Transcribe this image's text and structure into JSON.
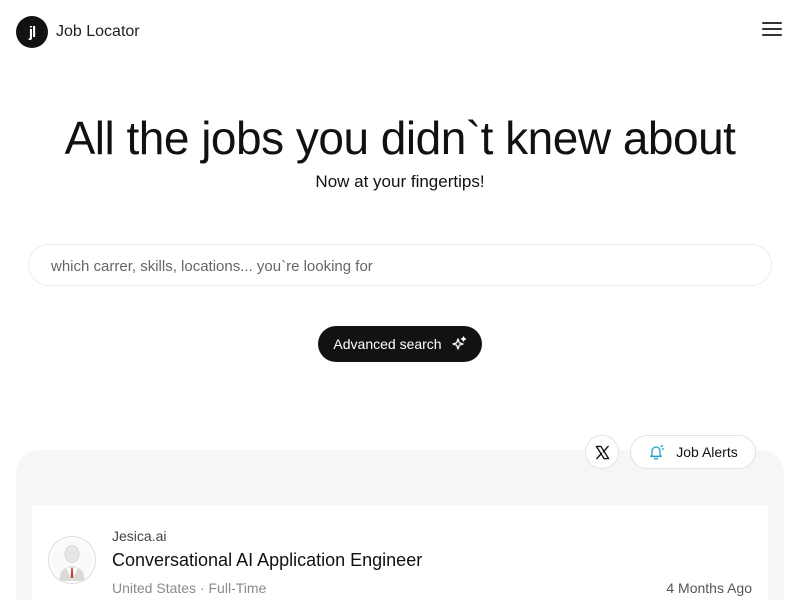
{
  "header": {
    "logo_text": "jl",
    "brand": "Job Locator",
    "menu_icon": "hamburger-icon"
  },
  "hero": {
    "title": "All the jobs you didn`t knew about",
    "subtitle": "Now at your fingertips!"
  },
  "search": {
    "placeholder": "which carrer, skills, locations... you`re looking for",
    "value": ""
  },
  "advanced_search": {
    "label": "Advanced search",
    "icon": "sparkle-icon"
  },
  "actions": {
    "x_icon": "x-logo-icon",
    "alerts_label": "Job Alerts",
    "alerts_icon": "bell-icon"
  },
  "colors": {
    "primary": "#121212",
    "panel_bg": "#f5f6f8",
    "accent": "#1aa3c8",
    "muted_text": "#8a8a8a"
  },
  "jobs": [
    {
      "company": "Jesica.ai",
      "title": "Conversational AI Application Engineer",
      "meta": "United States · Full-Time",
      "age": "4 Months Ago",
      "avatar_icon": "company-avatar-icon"
    }
  ]
}
